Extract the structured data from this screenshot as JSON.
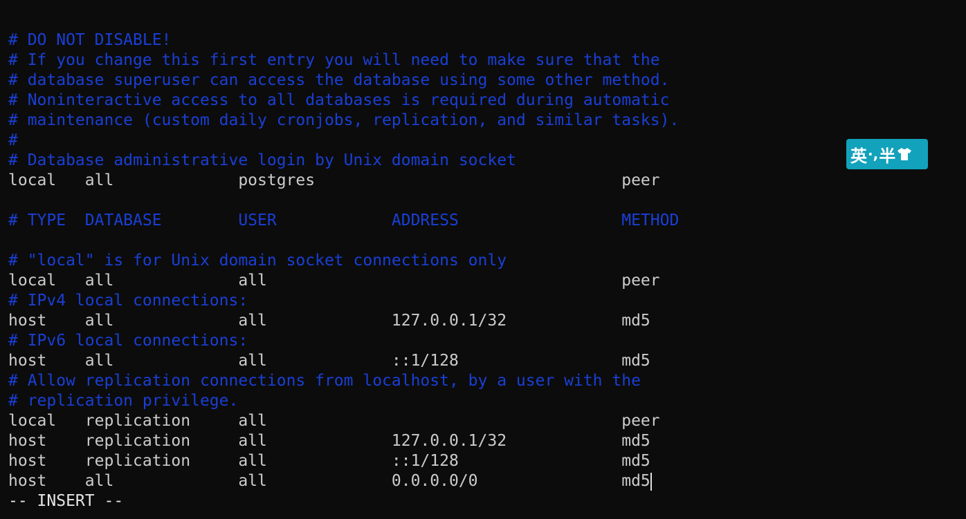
{
  "lines": [
    {
      "type": "comment",
      "text": "# DO NOT DISABLE!"
    },
    {
      "type": "comment",
      "text": "# If you change this first entry you will need to make sure that the"
    },
    {
      "type": "comment",
      "text": "# database superuser can access the database using some other method."
    },
    {
      "type": "comment",
      "text": "# Noninteractive access to all databases is required during automatic"
    },
    {
      "type": "comment",
      "text": "# maintenance (custom daily cronjobs, replication, and similar tasks)."
    },
    {
      "type": "comment",
      "text": "#"
    },
    {
      "type": "comment",
      "text": "# Database administrative login by Unix domain socket"
    },
    {
      "type": "text",
      "text": "local   all             postgres                                peer"
    },
    {
      "type": "blank",
      "text": ""
    },
    {
      "type": "comment",
      "text": "# TYPE  DATABASE        USER            ADDRESS                 METHOD"
    },
    {
      "type": "blank",
      "text": ""
    },
    {
      "type": "comment",
      "text": "# \"local\" is for Unix domain socket connections only"
    },
    {
      "type": "text",
      "text": "local   all             all                                     peer"
    },
    {
      "type": "comment",
      "text": "# IPv4 local connections:"
    },
    {
      "type": "text",
      "text": "host    all             all             127.0.0.1/32            md5"
    },
    {
      "type": "comment",
      "text": "# IPv6 local connections:"
    },
    {
      "type": "text",
      "text": "host    all             all             ::1/128                 md5"
    },
    {
      "type": "comment",
      "text": "# Allow replication connections from localhost, by a user with the"
    },
    {
      "type": "comment",
      "text": "# replication privilege."
    },
    {
      "type": "text",
      "text": "local   replication     all                                     peer"
    },
    {
      "type": "text",
      "text": "host    replication     all             127.0.0.1/32            md5"
    },
    {
      "type": "text",
      "text": "host    replication     all             ::1/128                 md5"
    },
    {
      "type": "text",
      "text": "host    all             all             0.0.0.0/0               md5"
    }
  ],
  "status": {
    "mode": "-- INSERT --"
  },
  "ime": {
    "language": "英",
    "punct": "·,",
    "width": "半",
    "icon": "shirt-icon"
  },
  "colors": {
    "background": "#0c0c0c",
    "comment": "#1a3fd6",
    "text": "#cccccc",
    "ime_background": "#12a2bb"
  }
}
